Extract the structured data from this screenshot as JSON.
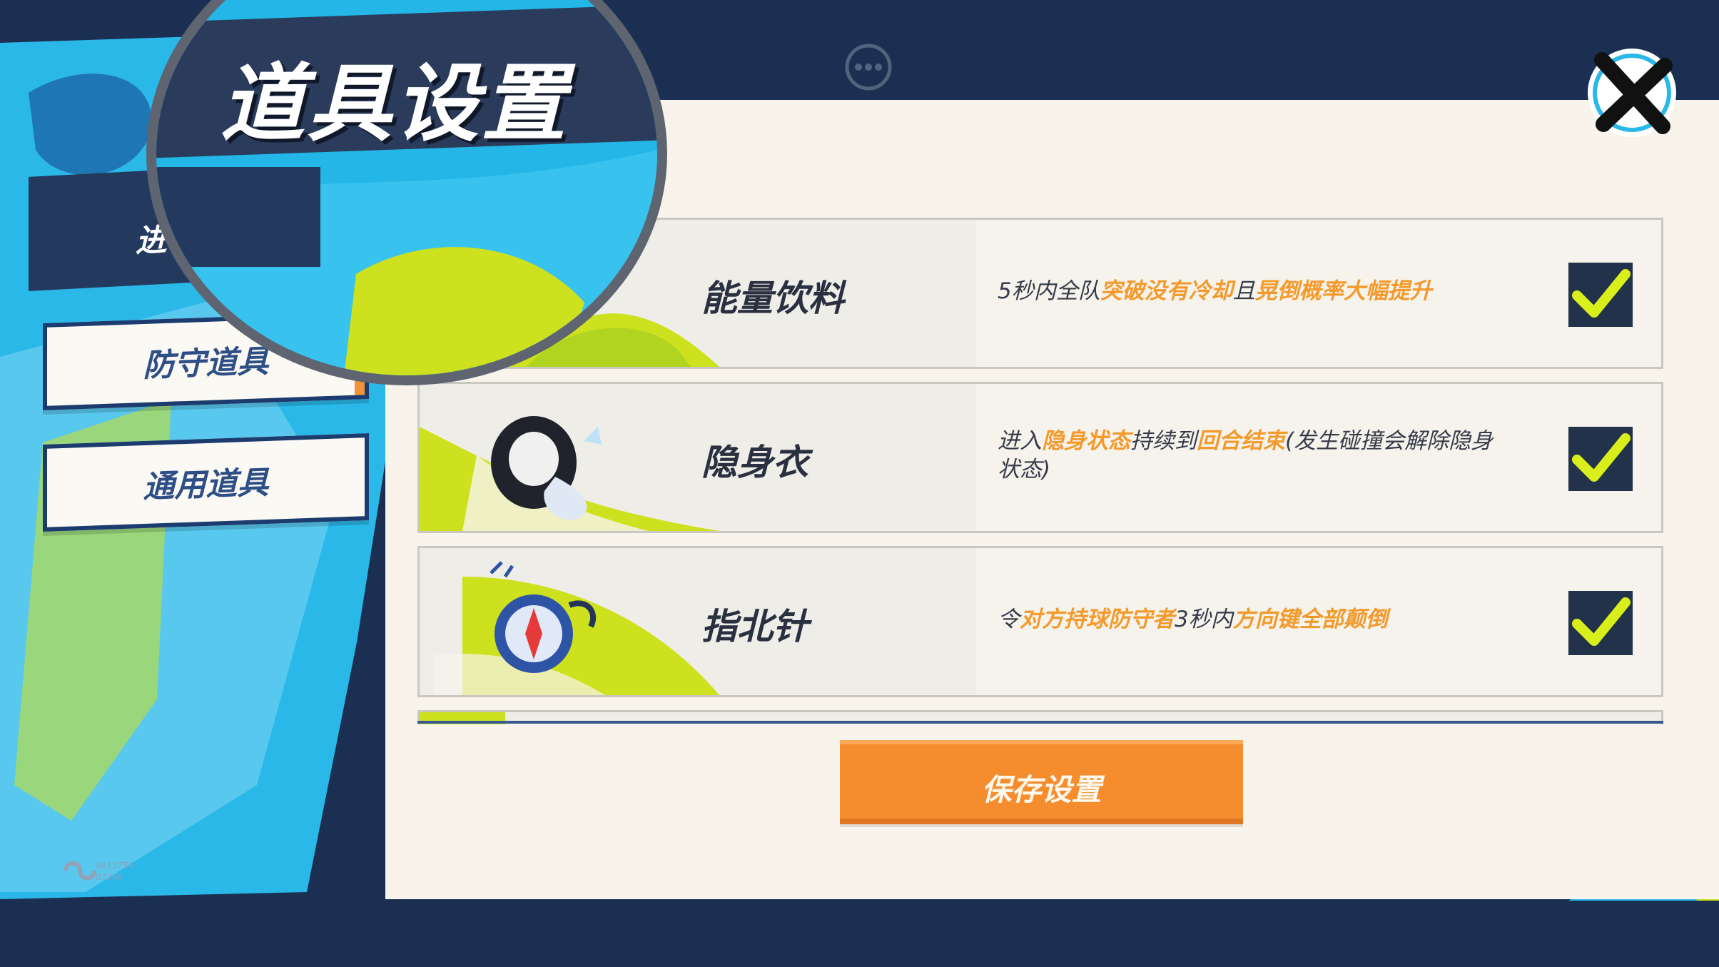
{
  "header": {
    "title": "道具设置",
    "close_icon": "close-x-icon",
    "chat_icon": "chat-bubble-icon"
  },
  "sidebar": {
    "active_tab_partial": "进",
    "tabs": [
      {
        "label": "防守道具",
        "active": false
      },
      {
        "label": "通用道具",
        "active": false
      }
    ]
  },
  "items": [
    {
      "name": "能量饮料",
      "desc_parts": [
        {
          "text": "5秒内全队",
          "highlight": false
        },
        {
          "text": "突破没有冷却",
          "highlight": true
        },
        {
          "text": "且",
          "highlight": false
        },
        {
          "text": "晃倒概率大幅提升",
          "highlight": true
        }
      ],
      "checked": true
    },
    {
      "name": "隐身衣",
      "desc_parts": [
        {
          "text": "进入",
          "highlight": false
        },
        {
          "text": "隐身状态",
          "highlight": true
        },
        {
          "text": "持续到",
          "highlight": false
        },
        {
          "text": "回合结束",
          "highlight": true
        },
        {
          "text": "(发生碰撞会解除隐身状态)",
          "highlight": false
        }
      ],
      "checked": true
    },
    {
      "name": "指北针",
      "desc_parts": [
        {
          "text": "令",
          "highlight": false
        },
        {
          "text": "对方持球防守者",
          "highlight": true
        },
        {
          "text": "3秒内",
          "highlight": false
        },
        {
          "text": "方向键全部颠倒",
          "highlight": true
        }
      ],
      "checked": true
    }
  ],
  "save_button": {
    "label": "保存设置"
  },
  "footer": {
    "uid_line1": "4613754",
    "uid_line2": "07246"
  },
  "colors": {
    "navy": "#1b2f52",
    "cyan": "#23b6e6",
    "lime": "#cde11f",
    "orange": "#f58d2e",
    "highlight": "#f39a2c",
    "panel": "#f8f4ec"
  }
}
